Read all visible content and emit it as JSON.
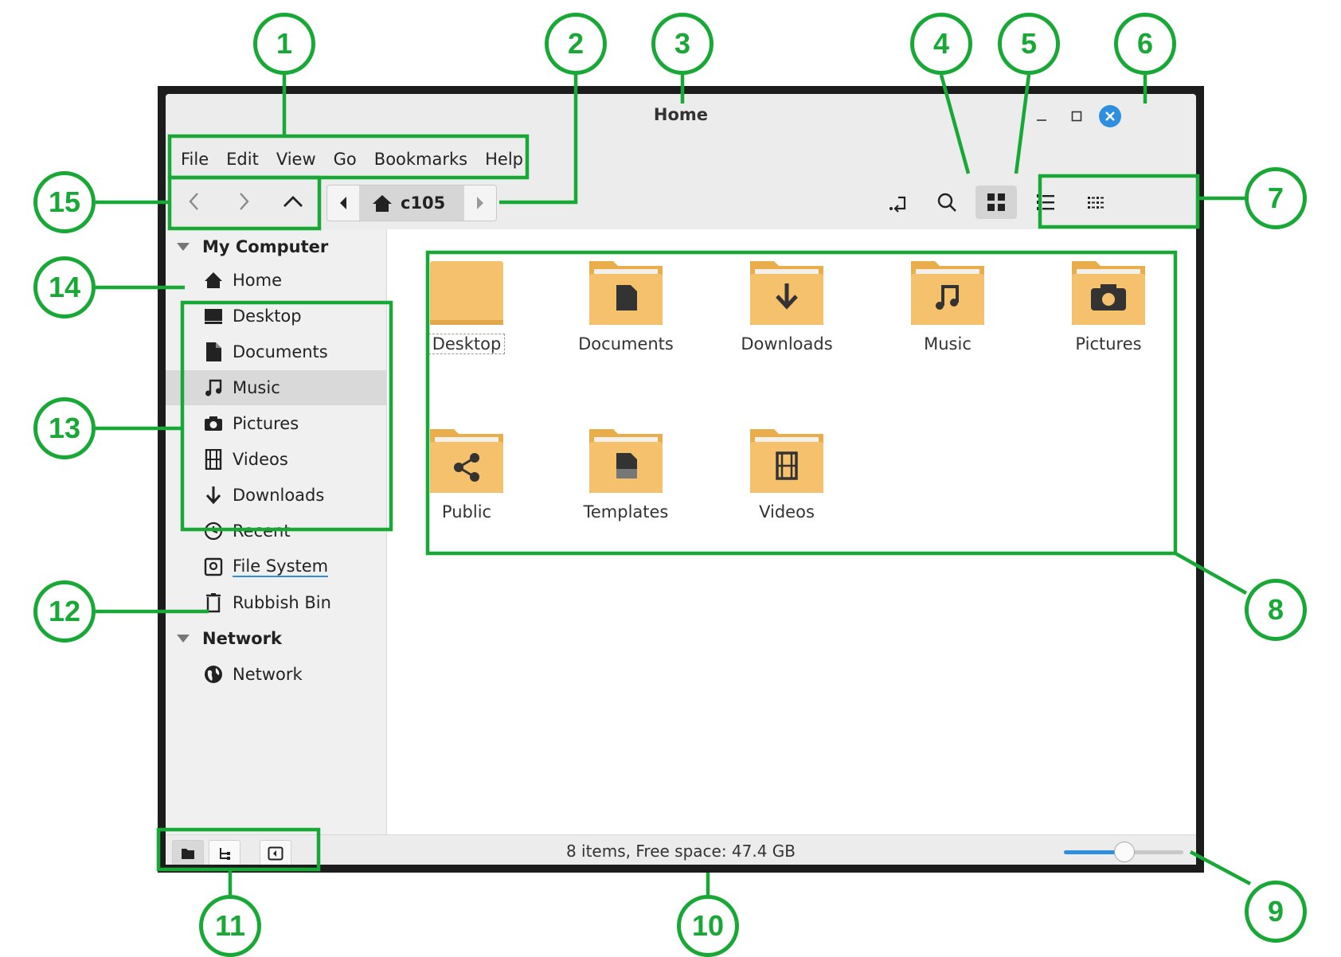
{
  "window": {
    "title": "Home"
  },
  "menu": [
    "File",
    "Edit",
    "View",
    "Go",
    "Bookmarks",
    "Help"
  ],
  "path": {
    "crumb": "c105",
    "home_icon": "home-icon"
  },
  "sidebar": {
    "sections": [
      {
        "title": "My Computer",
        "items": [
          {
            "label": "Home",
            "icon": "home-icon"
          },
          {
            "label": "Desktop",
            "icon": "desktop-icon"
          },
          {
            "label": "Documents",
            "icon": "document-icon"
          },
          {
            "label": "Music",
            "icon": "music-icon",
            "selected": true
          },
          {
            "label": "Pictures",
            "icon": "camera-icon"
          },
          {
            "label": "Videos",
            "icon": "film-icon"
          },
          {
            "label": "Downloads",
            "icon": "download-icon"
          },
          {
            "label": "Recent",
            "icon": "clock-icon"
          },
          {
            "label": "File System",
            "icon": "drive-icon"
          },
          {
            "label": "Rubbish Bin",
            "icon": "trash-icon"
          }
        ]
      },
      {
        "title": "Network",
        "items": [
          {
            "label": "Network",
            "icon": "globe-icon"
          }
        ]
      }
    ]
  },
  "files": [
    {
      "name": "Desktop",
      "icon": "folder-icon"
    },
    {
      "name": "Documents",
      "icon": "folder-documents-icon"
    },
    {
      "name": "Downloads",
      "icon": "folder-download-icon"
    },
    {
      "name": "Music",
      "icon": "folder-music-icon"
    },
    {
      "name": "Pictures",
      "icon": "folder-pictures-icon"
    },
    {
      "name": "Public",
      "icon": "folder-share-icon"
    },
    {
      "name": "Templates",
      "icon": "folder-templates-icon"
    },
    {
      "name": "Videos",
      "icon": "folder-videos-icon"
    }
  ],
  "status": {
    "text": "8 items, Free space: 47.4 GB",
    "zoom_fraction": 0.5
  },
  "callouts": [
    "1",
    "2",
    "3",
    "4",
    "5",
    "6",
    "7",
    "8",
    "9",
    "10",
    "11",
    "12",
    "13",
    "14",
    "15"
  ],
  "colors": {
    "annotation": "#18a836",
    "accent": "#2f8fdf",
    "folder": "#f5c16c",
    "folder_dark": "#e9ad4c",
    "window_bg": "#ececec"
  }
}
